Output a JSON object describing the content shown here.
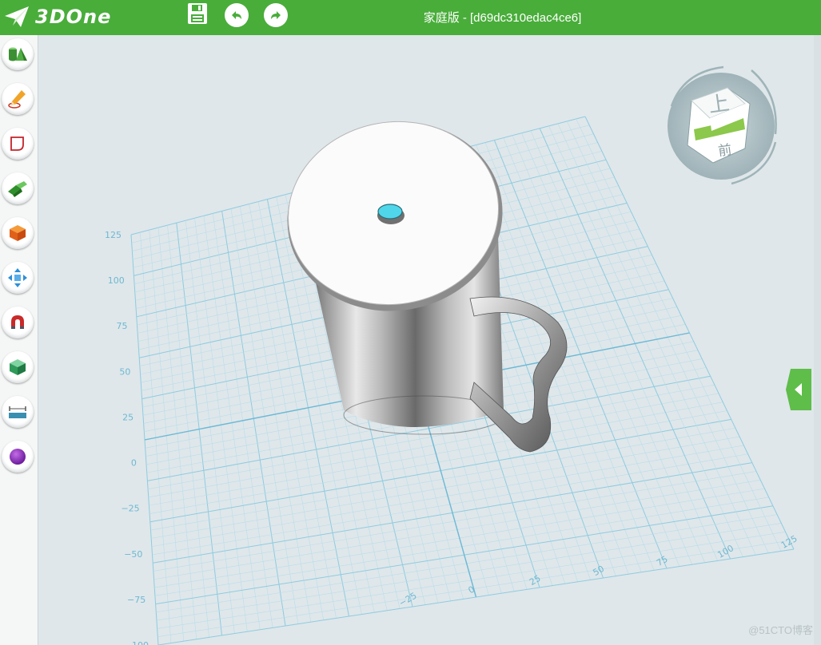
{
  "app": {
    "logo_text": "3DOne",
    "window_title": "家庭版 - [d69dc310edac4ce6]",
    "accent_color": "#49ad3a"
  },
  "topbar": {
    "icons": [
      "save-icon",
      "undo-icon",
      "redo-icon"
    ]
  },
  "toolbar": {
    "tools": [
      "basic-shapes-icon",
      "sketch-pencil-icon",
      "sketch-edit-icon",
      "feature-tool-icon",
      "special-function-icon",
      "move-icon",
      "combine-magnet-icon",
      "material-box-icon",
      "measure-icon",
      "color-sphere-icon"
    ]
  },
  "view_cube": {
    "top_label": "上",
    "front_label": "前"
  },
  "grid": {
    "left_labels": [
      "125",
      "100",
      "75",
      "50",
      "25",
      "0",
      "−25",
      "−50",
      "−75",
      "−100"
    ],
    "bottom_labels": [
      "−25",
      "0",
      "25",
      "50",
      "75",
      "100",
      "125"
    ]
  },
  "watermark": "@51CTO博客"
}
